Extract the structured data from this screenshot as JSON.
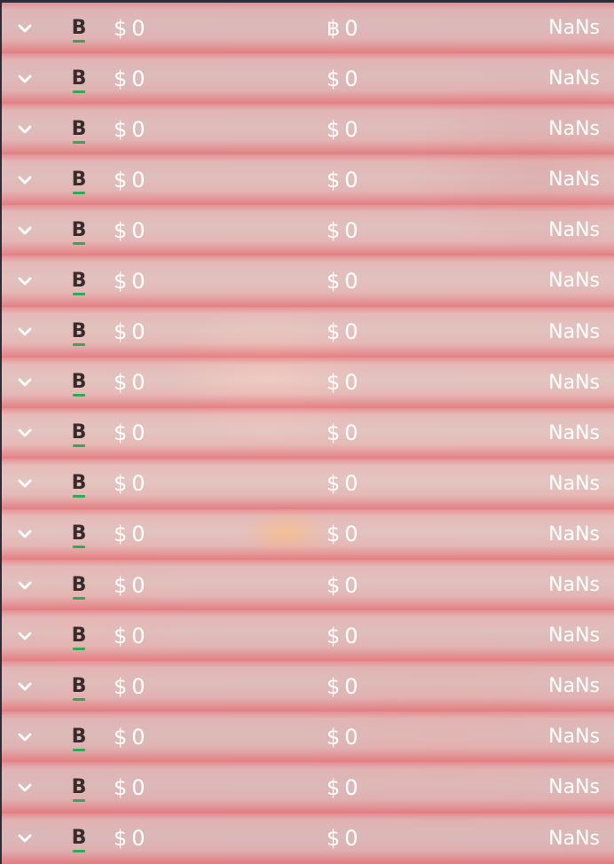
{
  "colors": {
    "row_edge": "#e46a70",
    "row_mid": "#e6c5c5",
    "coin_underline": "#2faa55",
    "text": "#ffffff",
    "coin_glyph": "#3a2b2c"
  },
  "icons": {
    "expand": "chevron-down-icon",
    "coin": "coin-b-icon"
  },
  "rows": [
    {
      "coin": "B",
      "fiat_symbol": "$",
      "fiat_value": "0",
      "crypto_symbol": "฿",
      "crypto_value": "0",
      "change": "NaNs"
    },
    {
      "coin": "B",
      "fiat_symbol": "$",
      "fiat_value": "0",
      "crypto_symbol": "$",
      "crypto_value": "0",
      "change": "NaNs"
    },
    {
      "coin": "B",
      "fiat_symbol": "$",
      "fiat_value": "0",
      "crypto_symbol": "$",
      "crypto_value": "0",
      "change": "NaNs"
    },
    {
      "coin": "B",
      "fiat_symbol": "$",
      "fiat_value": "0",
      "crypto_symbol": "$",
      "crypto_value": "0",
      "change": "NaNs"
    },
    {
      "coin": "B",
      "fiat_symbol": "$",
      "fiat_value": "0",
      "crypto_symbol": "$",
      "crypto_value": "0",
      "change": "NaNs"
    },
    {
      "coin": "B",
      "fiat_symbol": "$",
      "fiat_value": "0",
      "crypto_symbol": "$",
      "crypto_value": "0",
      "change": "NaNs"
    },
    {
      "coin": "B",
      "fiat_symbol": "$",
      "fiat_value": "0",
      "crypto_symbol": "$",
      "crypto_value": "0",
      "change": "NaNs"
    },
    {
      "coin": "B",
      "fiat_symbol": "$",
      "fiat_value": "0",
      "crypto_symbol": "$",
      "crypto_value": "0",
      "change": "NaNs"
    },
    {
      "coin": "B",
      "fiat_symbol": "$",
      "fiat_value": "0",
      "crypto_symbol": "$",
      "crypto_value": "0",
      "change": "NaNs"
    },
    {
      "coin": "B",
      "fiat_symbol": "$",
      "fiat_value": "0",
      "crypto_symbol": "$",
      "crypto_value": "0",
      "change": "NaNs"
    },
    {
      "coin": "B",
      "fiat_symbol": "$",
      "fiat_value": "0",
      "crypto_symbol": "$",
      "crypto_value": "0",
      "change": "NaNs"
    },
    {
      "coin": "B",
      "fiat_symbol": "$",
      "fiat_value": "0",
      "crypto_symbol": "$",
      "crypto_value": "0",
      "change": "NaNs"
    },
    {
      "coin": "B",
      "fiat_symbol": "$",
      "fiat_value": "0",
      "crypto_symbol": "$",
      "crypto_value": "0",
      "change": "NaNs"
    },
    {
      "coin": "B",
      "fiat_symbol": "$",
      "fiat_value": "0",
      "crypto_symbol": "$",
      "crypto_value": "0",
      "change": "NaNs"
    },
    {
      "coin": "B",
      "fiat_symbol": "$",
      "fiat_value": "0",
      "crypto_symbol": "$",
      "crypto_value": "0",
      "change": "NaNs"
    },
    {
      "coin": "B",
      "fiat_symbol": "$",
      "fiat_value": "0",
      "crypto_symbol": "$",
      "crypto_value": "0",
      "change": "NaNs"
    },
    {
      "coin": "B",
      "fiat_symbol": "$",
      "fiat_value": "0",
      "crypto_symbol": "$",
      "crypto_value": "0",
      "change": "NaNs"
    }
  ]
}
